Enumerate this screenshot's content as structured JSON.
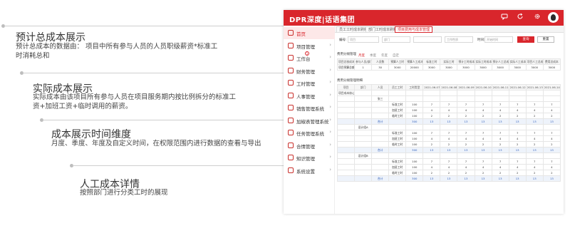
{
  "annotations": [
    {
      "title": "预计总成本展示",
      "desc": "预计总成本的数据由： 项目中所有参与人员的人员职级薪资*标准工时消耗总和"
    },
    {
      "title": "实际成本展示",
      "desc": "实际成本由该项目所有参与人员在项目服务期内按比例拆分的标准工资+加班工资+临时调用的薪资。"
    },
    {
      "title": "成本展示时间维度",
      "desc": "月度、季度、年度及自定义时间，在权限范围内进行数据的查看与导出"
    },
    {
      "title": "人工成本详情",
      "desc": "按照部门进行分类工时的展现"
    }
  ],
  "app": {
    "brand": "DPR深度|话语集团",
    "sidebar": [
      {
        "label": "首页",
        "active": true
      },
      {
        "label": "项目管理"
      },
      {
        "label": "工作台",
        "badge": "1"
      },
      {
        "label": "财务管理"
      },
      {
        "label": "工时管理"
      },
      {
        "label": "人事管理"
      },
      {
        "label": "销售管理系统"
      },
      {
        "label": "加椒表管理系统"
      },
      {
        "label": "任务管理系统"
      },
      {
        "label": "合情管理"
      },
      {
        "label": "知识管理"
      },
      {
        "label": "系统设置"
      }
    ],
    "tabs": [
      "员工工时成本刷新",
      "部门工时成本刷新",
      "项目费用与成本管理"
    ],
    "filters": {
      "label1": "编号:",
      "value1": "项目",
      "value2": "部门",
      "value3": "工作性质",
      "label4": "时间:",
      "value4": "开始时间",
      "query": "查询",
      "reset": "重置"
    },
    "summary_title": "费用分摊管理",
    "sub_tabs": [
      "月度",
      "季度",
      "年度",
      "自定"
    ],
    "summary_headers": [
      "项目总核成本额",
      "参与人员/部门",
      "人员数",
      "预算人工时",
      "预算人工成本",
      "标准工时",
      "实际工时",
      "预计工时成本",
      "实际工时成本",
      "预计人工总成本",
      "实际人工成本",
      "项目人工总成本",
      "费用总成本"
    ],
    "summary_row": [
      "项目预算总额",
      "1",
      "30",
      "3000",
      "20000",
      "3000",
      "3000",
      "3000",
      "3000",
      "3000",
      "3000",
      "3000",
      "3000"
    ],
    "detail_title": "费用分摊管理明细",
    "detail_headers": [
      "项目",
      "部门",
      "人员",
      "员工工时",
      "工时类型",
      "2021-06-07",
      "2021-06-08",
      "2021-06-09",
      "2021-06-10",
      "2021-06-11",
      "2021-06-12",
      "2021-06-13",
      "2021-06-14"
    ],
    "detail_rows": [
      {
        "cells": [
          "项目成本核心",
          "",
          "",
          "",
          "",
          "",
          "",
          "",
          "",
          "",
          "",
          "",
          ""
        ]
      },
      {
        "cells": [
          "",
          "",
          "张三",
          "",
          "",
          "",
          "",
          "",
          "",
          "",
          "",
          "",
          ""
        ]
      },
      {
        "cells": [
          "",
          "",
          "",
          "标准工时",
          "100",
          "7",
          "7",
          "7",
          "7",
          "7",
          "7",
          "7",
          "7"
        ]
      },
      {
        "cells": [
          "",
          "",
          "",
          "加班工时",
          "100",
          "4",
          "4",
          "4",
          "4",
          "4",
          "4",
          "4",
          "4"
        ]
      },
      {
        "cells": [
          "",
          "",
          "",
          "临时工时",
          "100",
          "2",
          "2",
          "2",
          "2",
          "2",
          "2",
          "2",
          "2"
        ]
      },
      {
        "cells": [
          "",
          "",
          "合计",
          "",
          "300",
          "13",
          "13",
          "13",
          "13",
          "13",
          "13",
          "13",
          "13"
        ],
        "sum": true
      },
      {
        "cells": [
          "",
          "设计组A",
          "",
          "",
          "",
          "",
          "",
          "",
          "",
          "",
          "",
          "",
          ""
        ]
      },
      {
        "cells": [
          "",
          "",
          "",
          "标准工时",
          "100",
          "7",
          "7",
          "7",
          "7",
          "7",
          "7",
          "7",
          "7"
        ]
      },
      {
        "cells": [
          "",
          "",
          "",
          "加班工时",
          "100",
          "4",
          "4",
          "4",
          "4",
          "4",
          "4",
          "4",
          "4"
        ]
      },
      {
        "cells": [
          "",
          "",
          "",
          "临时工时",
          "100",
          "2",
          "2",
          "2",
          "2",
          "2",
          "2",
          "2",
          "2"
        ]
      },
      {
        "cells": [
          "",
          "",
          "合计",
          "",
          "300",
          "13",
          "13",
          "13",
          "13",
          "13",
          "13",
          "13",
          "13"
        ],
        "sum": true
      },
      {
        "cells": [
          "",
          "设计组B",
          "",
          "",
          "",
          "",
          "",
          "",
          "",
          "",
          "",
          "",
          ""
        ]
      },
      {
        "cells": [
          "",
          "",
          "",
          "标准工时",
          "100",
          "7",
          "7",
          "7",
          "7",
          "7",
          "7",
          "7",
          "7"
        ]
      },
      {
        "cells": [
          "",
          "",
          "",
          "加班工时",
          "100",
          "4",
          "4",
          "4",
          "4",
          "4",
          "4",
          "4",
          "4"
        ]
      },
      {
        "cells": [
          "",
          "",
          "",
          "临时工时",
          "100",
          "2",
          "2",
          "2",
          "2",
          "2",
          "2",
          "2",
          "2"
        ]
      },
      {
        "cells": [
          "",
          "",
          "合计",
          "",
          "300",
          "13",
          "13",
          "13",
          "13",
          "13",
          "13",
          "13",
          "13"
        ],
        "sum": true
      }
    ]
  }
}
